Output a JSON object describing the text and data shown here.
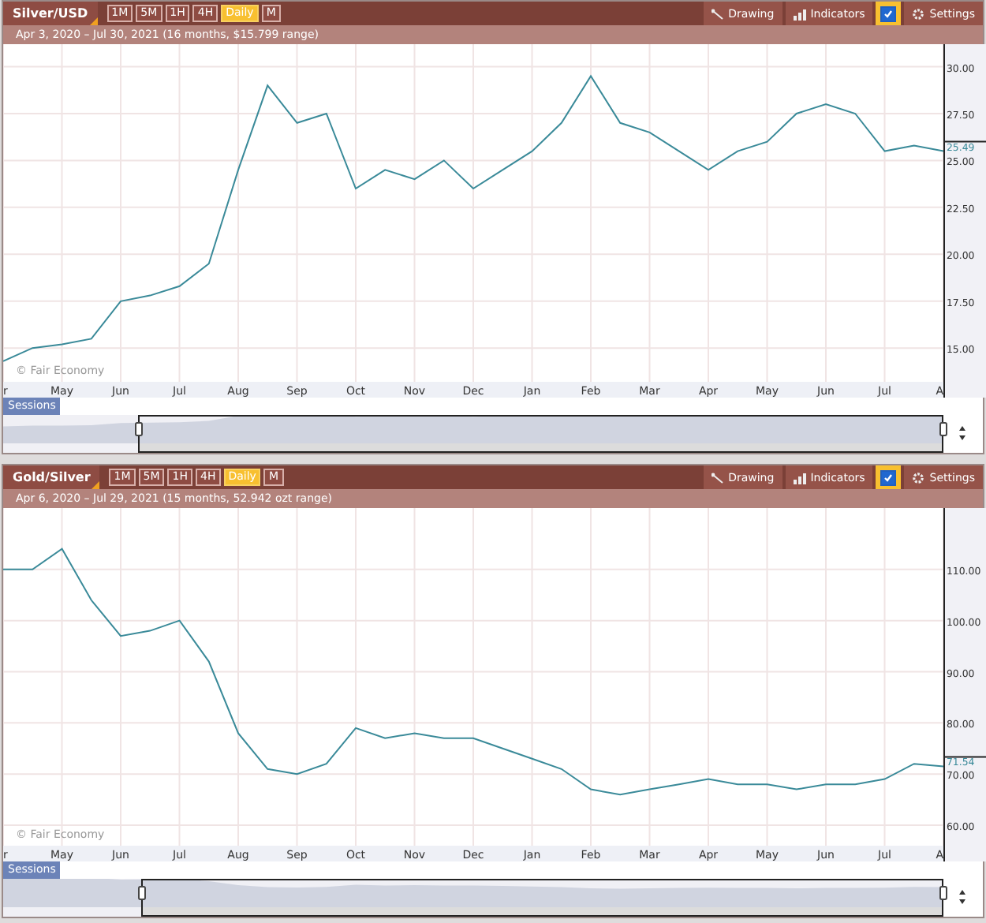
{
  "panels": [
    {
      "timeframes": [
        {
          "label": "1M",
          "selected": false
        },
        {
          "label": "5M",
          "selected": false
        },
        {
          "label": "1H",
          "selected": false
        },
        {
          "label": "4H",
          "selected": false
        },
        {
          "label": "Daily",
          "selected": true
        },
        {
          "label": "M",
          "selected": false
        }
      ],
      "tools": [
        {
          "kind": "drawing",
          "label": "Drawing"
        },
        {
          "kind": "indicators",
          "label": "Indicators"
        },
        {
          "kind": "toggle",
          "checked": true
        },
        {
          "kind": "settings",
          "label": "Settings"
        }
      ],
      "subtitle": "Apr 3, 2020 – Jul 30, 2021 (16 months, $15.799 range)",
      "attribution": "© Fair Economy",
      "last_value": "25.49",
      "sessions": "Sessions",
      "chart_data": {
        "type": "line",
        "categories": [
          "r",
          null,
          "May",
          null,
          "Jun",
          null,
          "Jul",
          null,
          "Aug",
          null,
          "Sep",
          null,
          "Oct",
          null,
          "Nov",
          null,
          "Dec",
          null,
          "Jan",
          null,
          "Feb",
          null,
          "Mar",
          null,
          "Apr",
          null,
          "May",
          null,
          "Jun",
          null,
          "Jul",
          null,
          "A"
        ],
        "series": [
          {
            "name": "Silver/USD",
            "color": "#3a8a99",
            "values": [
              14.3,
              15.0,
              15.2,
              15.5,
              17.5,
              17.8,
              18.3,
              19.5,
              24.5,
              29.0,
              27.0,
              27.5,
              23.5,
              24.5,
              24.0,
              25.0,
              23.5,
              24.5,
              25.5,
              27.0,
              29.5,
              27.0,
              26.5,
              25.5,
              24.5,
              25.5,
              26.0,
              27.5,
              28.0,
              27.5,
              25.5,
              25.8,
              25.5
            ]
          }
        ],
        "ylim": [
          13.2,
          31.2
        ],
        "grid": true,
        "yticks": [
          {
            "value": 15,
            "label": "15.00"
          },
          {
            "value": 17.5,
            "label": "17.50"
          },
          {
            "value": 20,
            "label": "20.00"
          },
          {
            "value": 22.5,
            "label": "22.50"
          },
          {
            "value": 25,
            "label": "25.00"
          },
          {
            "value": 27.5,
            "label": "27.50"
          },
          {
            "value": 30,
            "label": "30.00"
          }
        ]
      }
    },
    {
      "timeframes": [
        {
          "label": "1M",
          "selected": false
        },
        {
          "label": "5M",
          "selected": false
        },
        {
          "label": "1H",
          "selected": false
        },
        {
          "label": "4H",
          "selected": false
        },
        {
          "label": "Daily",
          "selected": true
        },
        {
          "label": "M",
          "selected": false
        }
      ],
      "tools": [
        {
          "kind": "drawing",
          "label": "Drawing"
        },
        {
          "kind": "indicators",
          "label": "Indicators"
        },
        {
          "kind": "toggle",
          "checked": true
        },
        {
          "kind": "settings",
          "label": "Settings"
        }
      ],
      "subtitle": "Apr 6, 2020 – Jul 29, 2021 (15 months, 52.942 ozt range)",
      "attribution": "© Fair Economy",
      "last_value": "71.54",
      "sessions": "Sessions",
      "chart_data": {
        "type": "line",
        "categories": [
          "r",
          null,
          "May",
          null,
          "Jun",
          null,
          "Jul",
          null,
          "Aug",
          null,
          "Sep",
          null,
          "Oct",
          null,
          "Nov",
          null,
          "Dec",
          null,
          "Jan",
          null,
          "Feb",
          null,
          "Mar",
          null,
          "Apr",
          null,
          "May",
          null,
          "Jun",
          null,
          "Jul",
          null,
          "A"
        ],
        "series": [
          {
            "name": "Gold/Silver",
            "color": "#3a8a99",
            "values": [
              110,
              110,
              114,
              104,
              97,
              98,
              100,
              92,
              78,
              71,
              70,
              72,
              79,
              77,
              78,
              77,
              77,
              75,
              73,
              71,
              67,
              66,
              67,
              68,
              69,
              68,
              68,
              67,
              68,
              68,
              69,
              72,
              71.5
            ]
          }
        ],
        "ylim": [
          56,
          122
        ],
        "grid": true,
        "yticks": [
          {
            "value": 60,
            "label": "60.00"
          },
          {
            "value": 70,
            "label": "70.00"
          },
          {
            "value": 80,
            "label": "80.00"
          },
          {
            "value": 90,
            "label": "90.00"
          },
          {
            "value": 100,
            "label": "100.00"
          },
          {
            "value": 110,
            "label": "110.00"
          }
        ]
      }
    }
  ]
}
